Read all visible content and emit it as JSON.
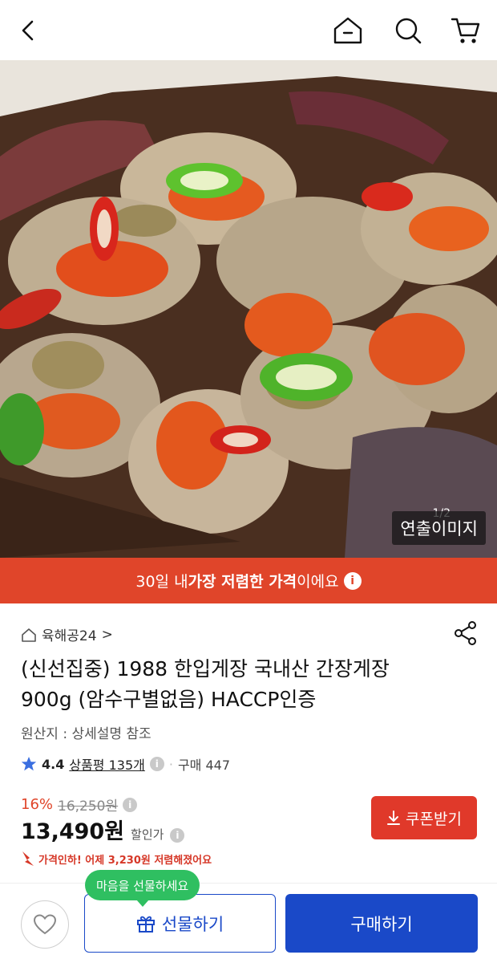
{
  "header": {
    "back_icon": "chevron-left-icon",
    "home_icon": "home-icon",
    "search_icon": "search-icon",
    "cart_icon": "cart-icon"
  },
  "hero": {
    "badge": "연출이미지",
    "counter": "1/2"
  },
  "promo": {
    "prefix": "30일 내 ",
    "highlight": "가장 저렴한 가격",
    "suffix": "이에요",
    "info": "i"
  },
  "product": {
    "store": "육해공24",
    "store_chevron": ">",
    "title_line1": "(신선집중) 1988 한입게장 국내산 간장게장",
    "title_line2": "900g (암수구별없음)  HACCP인증",
    "origin": "원산지 : 상세설명 참조",
    "rating": "4.4",
    "reviews": "상품평 135개",
    "purchases": "구매 447",
    "discount_pct": "16%",
    "original_price": "16,250원",
    "price": "13,490원",
    "price_label": "할인가",
    "price_drop": "가격인하! 어제 3,230원 저렴해졌어요"
  },
  "buttons": {
    "coupon": "쿠폰받기",
    "gift": "선물하기",
    "buy": "구매하기",
    "gift_tooltip": "마음을 선물하세요"
  },
  "colors": {
    "accent_red": "#e0452a",
    "brand_blue": "#1a49c8",
    "tooltip_green": "#2fbf61",
    "star_blue": "#3b6fe0"
  }
}
